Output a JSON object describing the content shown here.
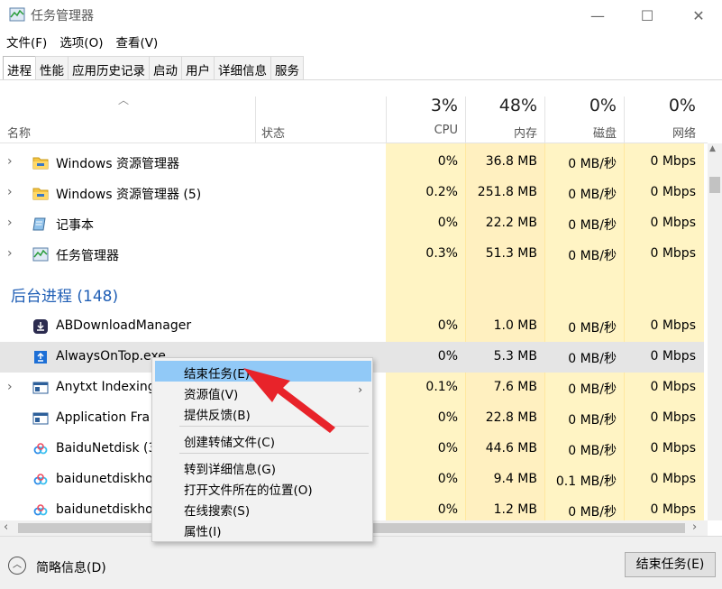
{
  "window": {
    "title": "任务管理器",
    "controls": {
      "minimize": "—",
      "maximize": "☐",
      "close": "✕"
    }
  },
  "menu": [
    "文件(F)",
    "选项(O)",
    "查看(V)"
  ],
  "tabs": [
    "进程",
    "性能",
    "应用历史记录",
    "启动",
    "用户",
    "详细信息",
    "服务"
  ],
  "active_tab": "进程",
  "columns": {
    "name": "名称",
    "status": "状态",
    "cpu": {
      "pct": "3%",
      "label": "CPU"
    },
    "mem": {
      "pct": "48%",
      "label": "内存"
    },
    "disk": {
      "pct": "0%",
      "label": "磁盘"
    },
    "net": {
      "pct": "0%",
      "label": "网络"
    }
  },
  "apps": [
    {
      "name": "Windows 资源管理器",
      "cpu": "0%",
      "mem": "36.8 MB",
      "disk": "0 MB/秒",
      "net": "0 Mbps",
      "icon": "folder-icon"
    },
    {
      "name": "Windows 资源管理器 (5)",
      "cpu": "0.2%",
      "mem": "251.8 MB",
      "disk": "0 MB/秒",
      "net": "0 Mbps",
      "icon": "folder-icon"
    },
    {
      "name": "记事本",
      "cpu": "0%",
      "mem": "22.2 MB",
      "disk": "0 MB/秒",
      "net": "0 Mbps",
      "icon": "notepad-icon"
    },
    {
      "name": "任务管理器",
      "cpu": "0.3%",
      "mem": "51.3 MB",
      "disk": "0 MB/秒",
      "net": "0 Mbps",
      "icon": "taskmgr-icon"
    }
  ],
  "background_title": "后台进程 (148)",
  "background": [
    {
      "name": "ABDownloadManager",
      "cpu": "0%",
      "mem": "1.0 MB",
      "disk": "0 MB/秒",
      "net": "0 Mbps",
      "icon": "download-icon"
    },
    {
      "name": "AlwaysOnTop.exe",
      "cpu": "0%",
      "mem": "5.3 MB",
      "disk": "0 MB/秒",
      "net": "0 Mbps",
      "icon": "app-icon"
    },
    {
      "name": "Anytxt Indexing",
      "cpu": "0.1%",
      "mem": "7.6 MB",
      "disk": "0 MB/秒",
      "net": "0 Mbps",
      "icon": "window-icon"
    },
    {
      "name": "Application Fra",
      "cpu": "0%",
      "mem": "22.8 MB",
      "disk": "0 MB/秒",
      "net": "0 Mbps",
      "icon": "window-icon"
    },
    {
      "name": "BaiduNetdisk (3",
      "cpu": "0%",
      "mem": "44.6 MB",
      "disk": "0 MB/秒",
      "net": "0 Mbps",
      "icon": "cloud-icon"
    },
    {
      "name": "baidunetdiskho",
      "cpu": "0%",
      "mem": "9.4 MB",
      "disk": "0.1 MB/秒",
      "net": "0 Mbps",
      "icon": "cloud-icon"
    },
    {
      "name": "baidunetdiskho",
      "cpu": "0%",
      "mem": "1.2 MB",
      "disk": "0 MB/秒",
      "net": "0 Mbps",
      "icon": "cloud-icon"
    }
  ],
  "context_menu": [
    "结束任务(E)",
    "资源值(V)",
    "提供反馈(B)",
    "创建转储文件(C)",
    "转到详细信息(G)",
    "打开文件所在的位置(O)",
    "在线搜索(S)",
    "属性(I)"
  ],
  "footer": {
    "fewer_details": "简略信息(D)",
    "end_task": "结束任务(E)"
  },
  "colors": {
    "accent": "#1f5eb5",
    "highlight": "#fff4c4",
    "menu_hover": "#91c9f7",
    "annotation": "#e8232a"
  }
}
